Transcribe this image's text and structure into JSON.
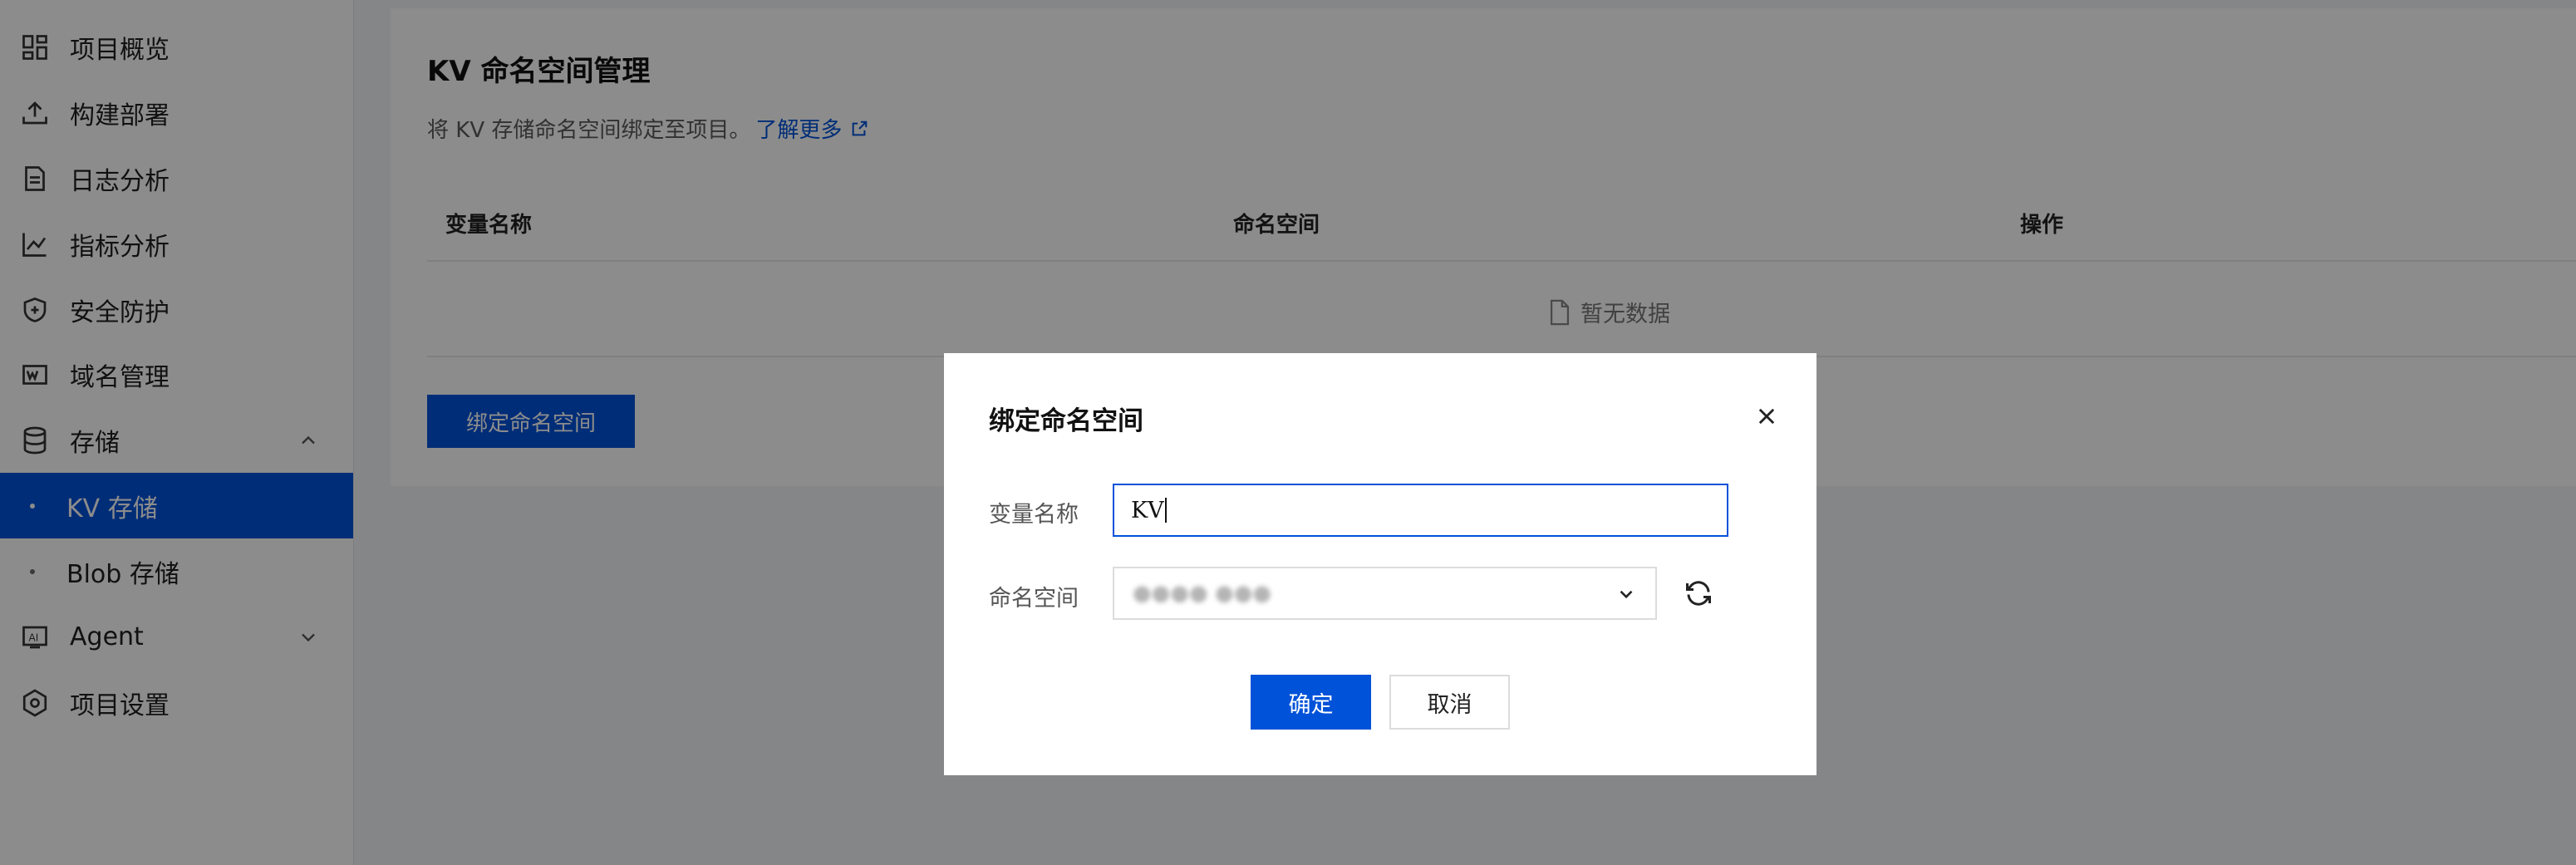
{
  "sidebar": {
    "items": [
      {
        "label": "项目概览",
        "icon": "dashboard-icon"
      },
      {
        "label": "构建部署",
        "icon": "upload-icon"
      },
      {
        "label": "日志分析",
        "icon": "document-icon"
      },
      {
        "label": "指标分析",
        "icon": "line-chart-icon"
      },
      {
        "label": "安全防护",
        "icon": "shield-icon"
      },
      {
        "label": "域名管理",
        "icon": "domain-icon"
      },
      {
        "label": "存储",
        "icon": "database-icon",
        "expanded": true
      },
      {
        "label": "KV 存储",
        "sub": true,
        "active": true
      },
      {
        "label": "Blob 存储",
        "sub": true
      },
      {
        "label": "Agent",
        "icon": "ai-icon",
        "expanded": false
      },
      {
        "label": "项目设置",
        "icon": "settings-icon"
      }
    ]
  },
  "main": {
    "title": "KV 命名空间管理",
    "description": "将 KV 存储命名空间绑定至项目。",
    "learn_more": "了解更多",
    "table": {
      "columns": [
        "变量名称",
        "命名空间",
        "操作"
      ],
      "empty_text": "暂无数据"
    },
    "bind_button": "绑定命名空间"
  },
  "dialog": {
    "title": "绑定命名空间",
    "var_label": "变量名称",
    "var_value": "KV",
    "ns_label": "命名空间",
    "ns_value": "●●●● ●●●",
    "ok": "确定",
    "cancel": "取消"
  },
  "colors": {
    "primary": "#0052d9",
    "mask": "rgba(0,0,0,0.45)"
  }
}
